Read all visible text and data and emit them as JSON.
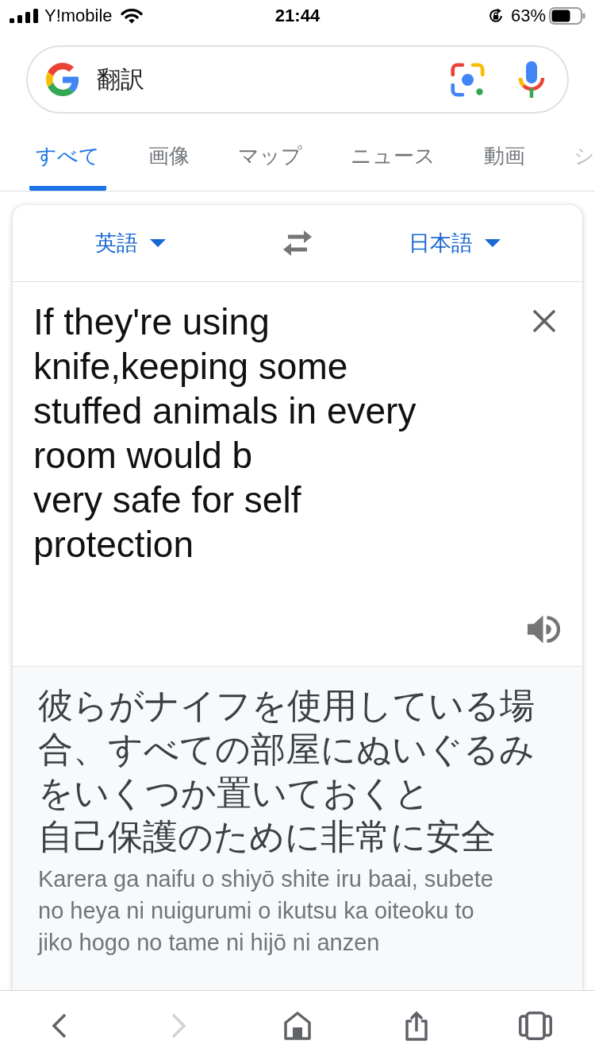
{
  "status_bar": {
    "carrier": "Y!mobile",
    "time": "21:44",
    "battery": "63%"
  },
  "search": {
    "query": "翻訳"
  },
  "tabs": [
    {
      "label": "すべて",
      "selected": true
    },
    {
      "label": "画像",
      "selected": false
    },
    {
      "label": "マップ",
      "selected": false
    },
    {
      "label": "ニュース",
      "selected": false
    },
    {
      "label": "動画",
      "selected": false
    },
    {
      "label": "シ",
      "selected": false
    }
  ],
  "translator": {
    "source_language": "英語",
    "target_language": "日本語",
    "source_text": "If they're using\nknife,keeping some\nstuffed animals in every\nroom would b\nvery safe for self\nprotection",
    "translation": [
      "彼らがナイフを使用している場合、すべての部屋にぬいぐるみをいくつか置いておくと",
      "自己保護のために非常に安全"
    ],
    "romanization": "Karera ga naifu o shiyō shite iru baai, subete\nno heya ni nuigurumi o ikutsu ka oiteoku to\njiko hogo no tame ni hijō ni anzen"
  },
  "toolbar": [
    {
      "kind": "back",
      "disabled": false
    },
    {
      "kind": "forward",
      "disabled": true
    },
    {
      "kind": "home",
      "disabled": false
    },
    {
      "kind": "share",
      "disabled": false
    },
    {
      "kind": "tabs",
      "disabled": false
    }
  ]
}
